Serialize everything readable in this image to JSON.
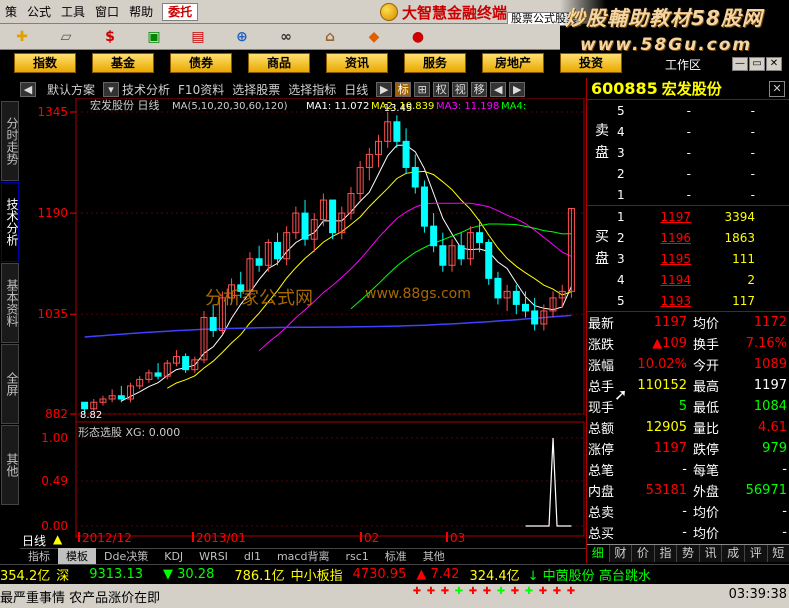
{
  "menu": {
    "items": [
      "策",
      "公式",
      "工具",
      "窗口",
      "帮助"
    ],
    "market_button": "委托",
    "logo_text": "大智慧金融终端",
    "formula_tab": "股票公式股票"
  },
  "watermark": {
    "line1": "炒股輔助教材58股网",
    "line2": "www.58Gu.com"
  },
  "toolbar": {
    "icons": [
      "diamond-icon",
      "ruler-icon",
      "dollar-icon",
      "money-icon",
      "chart-icon",
      "network-icon",
      "binoculars-icon",
      "bank-icon",
      "alert-icon",
      "car-icon"
    ]
  },
  "categories": [
    "指数",
    "基金",
    "债券",
    "商品",
    "资讯",
    "服务",
    "房地产",
    "投资"
  ],
  "work_area": "工作区",
  "vtabs": [
    "分时走势",
    "技术分析",
    "基本资料",
    "全屏",
    "其他"
  ],
  "chart_toolbar": {
    "items": [
      "默认方案",
      "技术分析",
      "F10资料",
      "选择股票",
      "选择指标",
      "日线"
    ],
    "buttons": [
      "▶",
      "标",
      "⊞",
      "权",
      "视",
      "移",
      "◀",
      "▶"
    ]
  },
  "chart": {
    "stock_label": "宏发股份 日线",
    "ma_label": "MA(5,10,20,30,60,120)",
    "ma_values": [
      {
        "k": "MA1: 11.072",
        "color": "#ffffff"
      },
      {
        "k": "MA2: 10.839",
        "color": "#ffff00"
      },
      {
        "k": "MA3: 11.198",
        "color": "#ff00ff"
      },
      {
        "k": "MA4:",
        "color": "#00ff00"
      }
    ],
    "y_labels": [
      "1345",
      "1190",
      "1035",
      "882"
    ],
    "high_label": "13.45",
    "low_label": "8.82",
    "sub_title": "形态选股  XG: 0.000",
    "sub_y_labels": [
      "1.00",
      "0.49",
      "0.00"
    ],
    "x_labels": [
      "2012/12",
      "2013/01",
      "02",
      "03"
    ],
    "watermark": "分析家公式网",
    "watermark2": "www.88gs.com"
  },
  "chart_data": {
    "type": "candlestick",
    "title": "宏发股份 日线",
    "ylim": [
      8.82,
      13.45
    ],
    "series_colors": {
      "up": "#ff5050",
      "down": "#00ffff"
    },
    "candles": [
      [
        9.0,
        9.0,
        8.82,
        8.9
      ],
      [
        8.9,
        9.05,
        8.85,
        9.0
      ],
      [
        9.0,
        9.1,
        8.95,
        9.05
      ],
      [
        9.05,
        9.2,
        9.0,
        9.1
      ],
      [
        9.1,
        9.25,
        9.0,
        9.05
      ],
      [
        9.05,
        9.3,
        9.0,
        9.25
      ],
      [
        9.25,
        9.4,
        9.2,
        9.35
      ],
      [
        9.35,
        9.5,
        9.3,
        9.45
      ],
      [
        9.45,
        9.6,
        9.35,
        9.4
      ],
      [
        9.4,
        9.65,
        9.35,
        9.6
      ],
      [
        9.6,
        9.8,
        9.55,
        9.7
      ],
      [
        9.7,
        9.75,
        9.45,
        9.5
      ],
      [
        9.5,
        9.7,
        9.45,
        9.65
      ],
      [
        9.65,
        10.4,
        9.6,
        10.3
      ],
      [
        10.3,
        10.5,
        10.0,
        10.1
      ],
      [
        10.1,
        10.7,
        10.05,
        10.6
      ],
      [
        10.6,
        10.9,
        10.5,
        10.8
      ],
      [
        10.8,
        11.0,
        10.6,
        10.7
      ],
      [
        10.7,
        11.3,
        10.6,
        11.2
      ],
      [
        11.2,
        11.4,
        11.0,
        11.1
      ],
      [
        11.1,
        11.5,
        11.0,
        11.45
      ],
      [
        11.45,
        11.6,
        11.1,
        11.2
      ],
      [
        11.2,
        11.7,
        11.1,
        11.6
      ],
      [
        11.6,
        12.0,
        11.5,
        11.9
      ],
      [
        11.9,
        12.1,
        11.4,
        11.5
      ],
      [
        11.5,
        11.9,
        11.3,
        11.8
      ],
      [
        11.8,
        12.2,
        11.7,
        12.1
      ],
      [
        12.1,
        12.0,
        11.5,
        11.6
      ],
      [
        11.6,
        12.0,
        11.5,
        11.9
      ],
      [
        11.9,
        12.3,
        11.8,
        12.2
      ],
      [
        12.2,
        12.7,
        12.1,
        12.6
      ],
      [
        12.6,
        12.9,
        12.4,
        12.8
      ],
      [
        12.8,
        13.1,
        12.6,
        13.0
      ],
      [
        13.0,
        13.45,
        12.9,
        13.3
      ],
      [
        13.3,
        13.4,
        12.9,
        13.0
      ],
      [
        13.0,
        13.2,
        12.5,
        12.6
      ],
      [
        12.6,
        12.8,
        12.2,
        12.3
      ],
      [
        12.3,
        12.4,
        11.6,
        11.7
      ],
      [
        11.7,
        11.9,
        11.3,
        11.4
      ],
      [
        11.4,
        11.6,
        11.0,
        11.1
      ],
      [
        11.1,
        11.5,
        11.0,
        11.4
      ],
      [
        11.4,
        11.6,
        11.1,
        11.2
      ],
      [
        11.2,
        11.7,
        11.1,
        11.6
      ],
      [
        11.6,
        11.8,
        11.3,
        11.45
      ],
      [
        11.45,
        11.5,
        10.8,
        10.9
      ],
      [
        10.9,
        11.0,
        10.5,
        10.6
      ],
      [
        10.6,
        10.8,
        10.4,
        10.7
      ],
      [
        10.7,
        10.8,
        10.35,
        10.5
      ],
      [
        10.5,
        10.7,
        10.3,
        10.4
      ],
      [
        10.4,
        10.6,
        10.1,
        10.2
      ],
      [
        10.2,
        10.5,
        10.1,
        10.4
      ],
      [
        10.4,
        10.7,
        10.3,
        10.6
      ],
      [
        10.6,
        10.8,
        10.45,
        10.7
      ],
      [
        10.7,
        11.97,
        10.6,
        11.97
      ]
    ],
    "sub_series": {
      "name": "XG",
      "ylim": [
        0,
        1
      ],
      "spike_index": 51
    }
  },
  "sub_period": {
    "label": "日线"
  },
  "bottom_tabs": [
    "指标",
    "模板",
    "Dde决策",
    "KDJ",
    "WRSI",
    "dl1",
    "macd背离",
    "rsc1",
    "标准",
    "其他"
  ],
  "right_panel": {
    "code": "600885",
    "name": "宏发股份",
    "sell_label": "卖盘",
    "buy_label": "买盘",
    "sells": [
      {
        "lv": "5",
        "px": "-",
        "vol": "-"
      },
      {
        "lv": "4",
        "px": "-",
        "vol": "-"
      },
      {
        "lv": "3",
        "px": "-",
        "vol": "-"
      },
      {
        "lv": "2",
        "px": "-",
        "vol": "-"
      },
      {
        "lv": "1",
        "px": "-",
        "vol": "-"
      }
    ],
    "buys": [
      {
        "lv": "1",
        "px": "1197",
        "vol": "3394"
      },
      {
        "lv": "2",
        "px": "1196",
        "vol": "1863"
      },
      {
        "lv": "3",
        "px": "1195",
        "vol": "111"
      },
      {
        "lv": "4",
        "px": "1194",
        "vol": "2"
      },
      {
        "lv": "5",
        "px": "1193",
        "vol": "117"
      }
    ],
    "quote": [
      {
        "k": "最新",
        "v": "1197",
        "k2": "均价",
        "v2": "1172"
      },
      {
        "k": "涨跌",
        "v": "▲109",
        "k2": "换手",
        "v2": "7.16%"
      },
      {
        "k": "涨幅",
        "v": "10.02%",
        "k2": "今开",
        "v2": "1089"
      },
      {
        "k": "总手",
        "v": "110152",
        "k2": "最高",
        "v2": "1197"
      },
      {
        "k": "现手",
        "v": "5",
        "k2": "最低",
        "v2": "1084"
      },
      {
        "k": "总额",
        "v": "12905",
        "k2": "量比",
        "v2": "4.61"
      },
      {
        "k": "涨停",
        "v": "1197",
        "k2": "跌停",
        "v2": "979"
      },
      {
        "k": "总笔",
        "v": "-",
        "k2": "每笔",
        "v2": "-"
      },
      {
        "k": "内盘",
        "v": "53181",
        "k2": "外盘",
        "v2": "56971"
      },
      {
        "k": "总卖",
        "v": "-",
        "k2": "均价",
        "v2": "-"
      },
      {
        "k": "总买",
        "v": "-",
        "k2": "均价",
        "v2": "-"
      }
    ],
    "tabs": [
      "细",
      "财",
      "价",
      "指",
      "势",
      "讯",
      "成",
      "评",
      "短"
    ]
  },
  "status1": {
    "a": "354.2亿",
    "b": "深",
    "c": "9313.13",
    "d": "▼ 30.28",
    "e": "786.1亿",
    "f": "中小板指",
    "g": "4730.95",
    "h": "▲ 7.42",
    "i": "324.4亿",
    "j": "↓ 中茵股份 高台跳水"
  },
  "status2": {
    "text": "最严重事情 农产品涨价在即",
    "clock": "03:39:38"
  }
}
